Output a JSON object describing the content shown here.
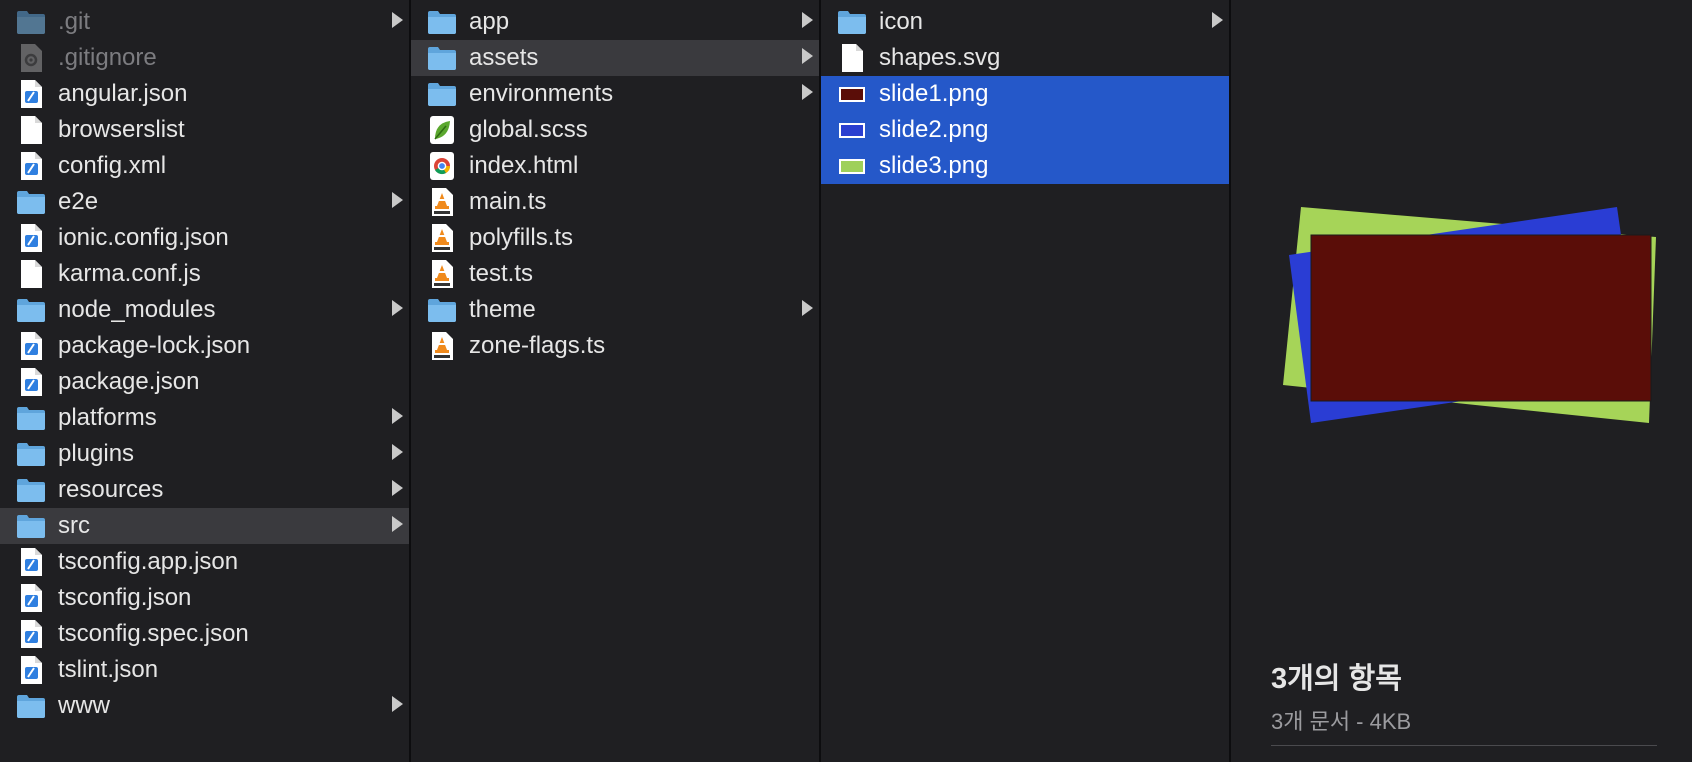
{
  "columns": [
    {
      "items": [
        {
          "name": "git-folder",
          "label": ".git",
          "icon": "folder-icon",
          "chevron": true,
          "dim": true
        },
        {
          "name": "gitignore-file",
          "label": ".gitignore",
          "icon": "gear-file-icon",
          "chevron": false,
          "dim": true
        },
        {
          "name": "angular-json",
          "label": "angular.json",
          "icon": "xcode-file-icon",
          "chevron": false
        },
        {
          "name": "browserslist",
          "label": "browserslist",
          "icon": "blank-file-icon",
          "chevron": false
        },
        {
          "name": "config-xml",
          "label": "config.xml",
          "icon": "xcode-file-icon",
          "chevron": false
        },
        {
          "name": "e2e-folder",
          "label": "e2e",
          "icon": "folder-icon",
          "chevron": true
        },
        {
          "name": "ionic-config-json",
          "label": "ionic.config.json",
          "icon": "xcode-file-icon",
          "chevron": false
        },
        {
          "name": "karma-conf-js",
          "label": "karma.conf.js",
          "icon": "blank-file-icon",
          "chevron": false
        },
        {
          "name": "node-modules-folder",
          "label": "node_modules",
          "icon": "folder-icon",
          "chevron": true
        },
        {
          "name": "package-lock-json",
          "label": "package-lock.json",
          "icon": "xcode-file-icon",
          "chevron": false
        },
        {
          "name": "package-json",
          "label": "package.json",
          "icon": "xcode-file-icon",
          "chevron": false
        },
        {
          "name": "platforms-folder",
          "label": "platforms",
          "icon": "folder-icon",
          "chevron": true
        },
        {
          "name": "plugins-folder",
          "label": "plugins",
          "icon": "folder-icon",
          "chevron": true
        },
        {
          "name": "resources-folder",
          "label": "resources",
          "icon": "folder-icon",
          "chevron": true
        },
        {
          "name": "src-folder",
          "label": "src",
          "icon": "folder-icon",
          "chevron": true,
          "selected": "gray"
        },
        {
          "name": "tsconfig-app-json",
          "label": "tsconfig.app.json",
          "icon": "xcode-file-icon",
          "chevron": false
        },
        {
          "name": "tsconfig-json",
          "label": "tsconfig.json",
          "icon": "xcode-file-icon",
          "chevron": false
        },
        {
          "name": "tsconfig-spec-json",
          "label": "tsconfig.spec.json",
          "icon": "xcode-file-icon",
          "chevron": false
        },
        {
          "name": "tslint-json",
          "label": "tslint.json",
          "icon": "xcode-file-icon",
          "chevron": false
        },
        {
          "name": "www-folder",
          "label": "www",
          "icon": "folder-icon",
          "chevron": true
        }
      ]
    },
    {
      "items": [
        {
          "name": "app-folder",
          "label": "app",
          "icon": "folder-icon",
          "chevron": true
        },
        {
          "name": "assets-folder",
          "label": "assets",
          "icon": "folder-icon",
          "chevron": true,
          "selected": "gray"
        },
        {
          "name": "environments-folder",
          "label": "environments",
          "icon": "folder-icon",
          "chevron": true
        },
        {
          "name": "global-scss",
          "label": "global.scss",
          "icon": "leaf-file-icon",
          "chevron": false
        },
        {
          "name": "index-html",
          "label": "index.html",
          "icon": "chrome-file-icon",
          "chevron": false
        },
        {
          "name": "main-ts",
          "label": "main.ts",
          "icon": "vlc-file-icon",
          "chevron": false
        },
        {
          "name": "polyfills-ts",
          "label": "polyfills.ts",
          "icon": "vlc-file-icon",
          "chevron": false
        },
        {
          "name": "test-ts",
          "label": "test.ts",
          "icon": "vlc-file-icon",
          "chevron": false
        },
        {
          "name": "theme-folder",
          "label": "theme",
          "icon": "folder-icon",
          "chevron": true
        },
        {
          "name": "zone-flags-ts",
          "label": "zone-flags.ts",
          "icon": "vlc-file-icon",
          "chevron": false
        }
      ]
    },
    {
      "items": [
        {
          "name": "icon-folder",
          "label": "icon",
          "icon": "folder-icon",
          "chevron": true
        },
        {
          "name": "shapes-svg",
          "label": "shapes.svg",
          "icon": "blank-file-icon",
          "chevron": false
        },
        {
          "name": "slide1-png",
          "label": "slide1.png",
          "icon": "image-swatch-icon",
          "swatch": "#5a0d08",
          "chevron": false,
          "selected": "blue"
        },
        {
          "name": "slide2-png",
          "label": "slide2.png",
          "icon": "image-swatch-icon",
          "swatch": "#2a3fd0",
          "chevron": false,
          "selected": "blue"
        },
        {
          "name": "slide3-png",
          "label": "slide3.png",
          "icon": "image-swatch-icon",
          "swatch": "#9fd05a",
          "chevron": false,
          "selected": "blue"
        }
      ]
    }
  ],
  "preview": {
    "title": "3개의 항목",
    "subtitle": "3개 문서 - 4KB",
    "colors": {
      "green": "#a6d458",
      "blue": "#2a3dd4",
      "red": "#5a0d08"
    }
  },
  "colors": {
    "folder": "#72b4e8",
    "selection_blue": "#2558c9",
    "selection_gray": "#3a3a3e"
  }
}
